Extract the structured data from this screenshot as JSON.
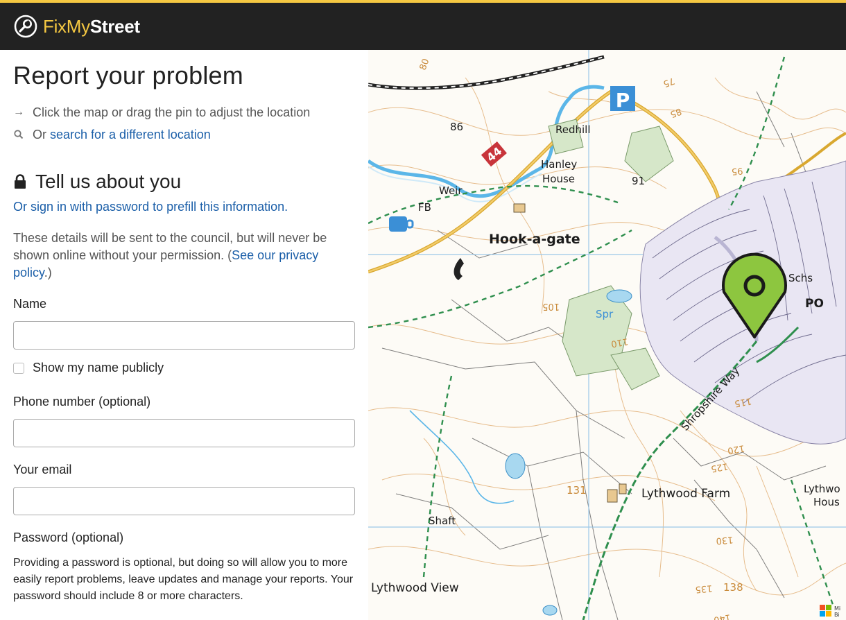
{
  "header": {
    "brand_fix": "FixMy",
    "brand_street": "Street",
    "logo_icon": "wrench-in-circle-icon",
    "colors": {
      "bar": "#222222",
      "accent": "#f5c842"
    }
  },
  "form": {
    "title": "Report your problem",
    "hint_map": "Click the map or drag the pin to adjust the location",
    "hint_search_prefix": "Or ",
    "hint_search_link": "search for a different location",
    "section_title": "Tell us about you",
    "signin_link": "Or sign in with password to prefill this information.",
    "privacy_text": "These details will be sent to the council, but will never be shown online without your permission. (",
    "privacy_link": "See our privacy policy",
    "privacy_end": ".)",
    "name_label": "Name",
    "name_value": "",
    "show_name_label": "Show my name publicly",
    "show_name_checked": false,
    "phone_label": "Phone number (optional)",
    "phone_value": "",
    "email_label": "Your email",
    "email_value": "",
    "password_label": "Password (optional)",
    "password_note": "Providing a password is optional, but doing so will allow you to more easily report problems, leave updates and manage your reports. Your password should include 8 or more characters."
  },
  "map": {
    "pin_color": "#8dc63f",
    "labels": {
      "redhill": "Redhill",
      "hanley": "Hanley",
      "house": "House",
      "weir": "Weir",
      "fb": "FB",
      "hook": "Hook-a-gate",
      "spr": "Spr",
      "schs": "Schs",
      "po": "PO",
      "shropshire": "Shropshire Way",
      "lythwood_farm": "Lythwood Farm",
      "lythwood_house_1": "Lythwo",
      "lythwood_house_2": "Hous",
      "shaft": "Shaft",
      "lythwood_view": "Lythwood View",
      "parking": "P",
      "road_number": "44",
      "h86": "86",
      "h91": "91",
      "h131": "131",
      "h138": "138",
      "c80": "80",
      "c75": "75",
      "c85": "85",
      "c95": "95",
      "c105": "105",
      "c110": "110",
      "c115": "115",
      "c120": "120",
      "c125": "125",
      "c130": "130",
      "c135": "135",
      "c140": "140",
      "ms_1": "Mi",
      "ms_2": "Bi"
    }
  }
}
